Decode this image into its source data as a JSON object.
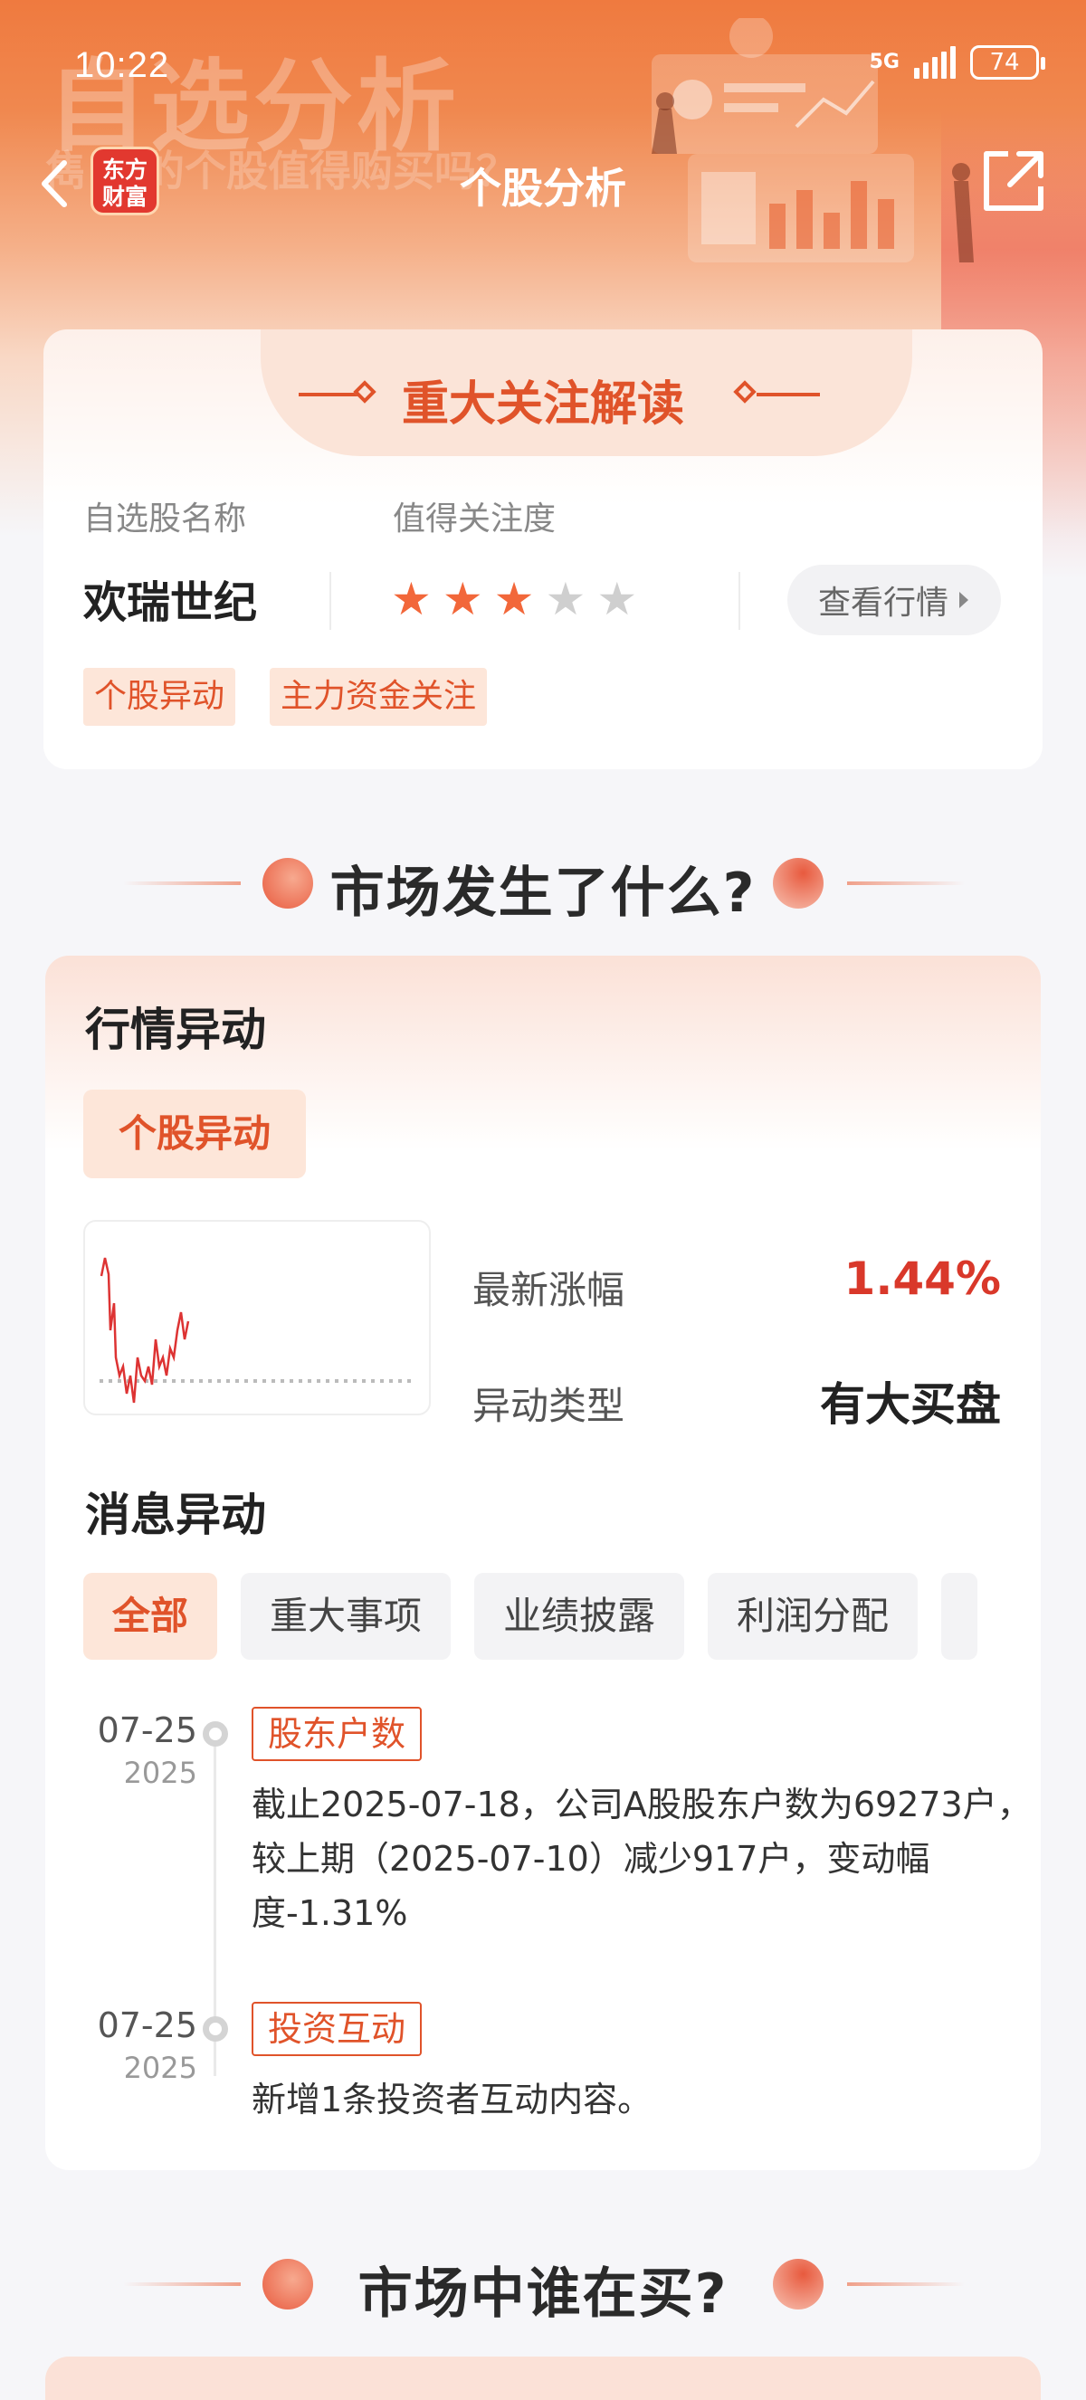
{
  "status_bar": {
    "time": "10:22",
    "network": "5G",
    "battery": "74"
  },
  "header": {
    "banner_title": "自选分析",
    "banner_subtitle": "雋 我的个股值得购买吗？",
    "logo_text": "东方财富",
    "title": "个股分析"
  },
  "focus_card": {
    "title": "重大关注解读",
    "stock_label": "自选股名称",
    "attention_label": "值得关注度",
    "stock_name": "欢瑞世纪",
    "rating": 3,
    "rating_max": 5,
    "view_button": "查看行情",
    "tags": [
      "个股异动",
      "主力资金关注"
    ]
  },
  "section1": {
    "title": "市场发生了什么?"
  },
  "market_card": {
    "quote_heading": "行情异动",
    "quote_tag": "个股异动",
    "metrics": [
      {
        "label": "最新涨幅",
        "value": "1.44%",
        "color": "#d9382a"
      },
      {
        "label": "异动类型",
        "value": "有大买盘",
        "color": "#222222"
      }
    ],
    "news_heading": "消息异动",
    "filters": [
      "全部",
      "重大事项",
      "业绩披露",
      "利润分配"
    ],
    "active_filter": "全部",
    "timeline": [
      {
        "date": "07-25",
        "year": "2025",
        "tag": "股东户数",
        "text": "截止2025-07-18，公司A股股东户数为69273户，较上期（2025-07-10）减少917户，变动幅度-1.31%"
      },
      {
        "date": "07-25",
        "year": "2025",
        "tag": "投资互动",
        "text": "新增1条投资者互动内容。"
      }
    ]
  },
  "section2": {
    "title": "市场中谁在买?"
  },
  "colors": {
    "accent": "#e0532a",
    "up": "#d9382a",
    "star_on": "#f2673a",
    "star_off": "#cfcfcf"
  }
}
